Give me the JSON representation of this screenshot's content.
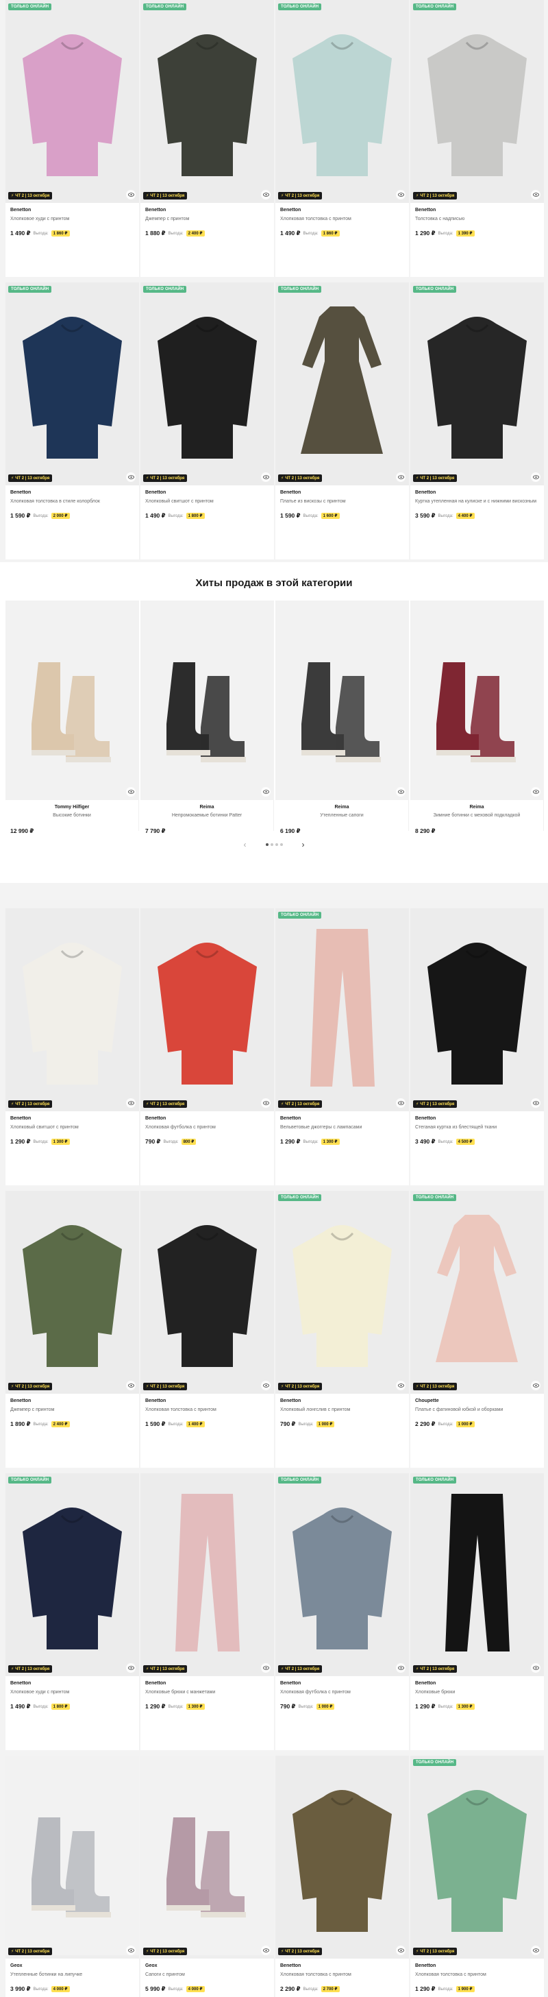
{
  "ui": {
    "badge": "Только онлайн",
    "delivery": "ЧТ 2 | 13 октября",
    "save_label": "Выгода:",
    "hits_title": "Хиты продаж в этой категории",
    "prev_arrow": "‹",
    "next_arrow": "›"
  },
  "colors": {
    "accent_green": "#56b887",
    "highlight_yellow": "#ffe052",
    "text": "#1a1a1a",
    "muted": "#666666"
  },
  "grid_top": [
    {
      "brand": "Benetton",
      "name": "Хлопковое худи с принтом",
      "price": "1 490 ₽",
      "save": "1 860 ₽",
      "badge": true,
      "color": "#d9a0c8"
    },
    {
      "brand": "Benetton",
      "name": "Джемпер с принтом",
      "price": "1 880 ₽",
      "save": "2 400 ₽",
      "badge": true,
      "color": "#3d4038"
    },
    {
      "brand": "Benetton",
      "name": "Хлопковая толстовка с принтом",
      "price": "1 490 ₽",
      "save": "1 860 ₽",
      "badge": true,
      "color": "#bcd6d3"
    },
    {
      "brand": "Benetton",
      "name": "Толстовка с надписью",
      "price": "1 290 ₽",
      "save": "1 390 ₽",
      "badge": true,
      "color": "#c9c9c7"
    },
    {
      "brand": "Benetton",
      "name": "Хлопковая толстовка в стиле колорблок",
      "price": "1 590 ₽",
      "save": "2 000 ₽",
      "badge": true,
      "color": "#1e3557"
    },
    {
      "brand": "Benetton",
      "name": "Хлопковый свитшот с принтом",
      "price": "1 490 ₽",
      "save": "1 800 ₽",
      "badge": true,
      "color": "#1f1f1f"
    },
    {
      "brand": "Benetton",
      "name": "Платье из вискозы с принтом",
      "price": "1 590 ₽",
      "save": "1 600 ₽",
      "badge": true,
      "color": "#56503f"
    },
    {
      "brand": "Benetton",
      "name": "Куртка утепленная на кулиске и с нижними вискозным",
      "price": "3 590 ₽",
      "save": "4 400 ₽",
      "badge": true,
      "color": "#262626"
    }
  ],
  "hits": [
    {
      "brand": "Tommy Hilfiger",
      "name": "Высокие ботинки",
      "price": "12 990 ₽",
      "color": "#dcc7ac"
    },
    {
      "brand": "Reima",
      "name": "Непромокаемые ботинки Patter",
      "price": "7 790 ₽",
      "color": "#2c2c2c"
    },
    {
      "brand": "Reima",
      "name": "Утепленные сапоги",
      "price": "6 190 ₽",
      "color": "#3b3b3b"
    },
    {
      "brand": "Reima",
      "name": "Зимние ботинки с меховой подкладкой",
      "price": "8 290 ₽",
      "color": "#7f2632"
    }
  ],
  "grid_bottom": [
    {
      "brand": "Benetton",
      "name": "Хлопковый свитшот с принтом",
      "price": "1 290 ₽",
      "save": "1 300 ₽",
      "badge": false,
      "color": "#f1efe9"
    },
    {
      "brand": "Benetton",
      "name": "Хлопковая футболка с принтом",
      "price": "790 ₽",
      "save": "800 ₽",
      "badge": false,
      "color": "#d9463a"
    },
    {
      "brand": "Benetton",
      "name": "Вельветовые джоггеры с лампасами",
      "price": "1 290 ₽",
      "save": "1 300 ₽",
      "badge": true,
      "color": "#e7bdb4"
    },
    {
      "brand": "Benetton",
      "name": "Стеганая куртка из блестящей ткани",
      "price": "3 490 ₽",
      "save": "4 500 ₽",
      "badge": false,
      "color": "#161616"
    },
    {
      "brand": "Benetton",
      "name": "Джемпер с принтом",
      "price": "1 890 ₽",
      "save": "2 400 ₽",
      "badge": false,
      "color": "#5b6b48"
    },
    {
      "brand": "Benetton",
      "name": "Хлопковая толстовка с принтом",
      "price": "1 590 ₽",
      "save": "1 400 ₽",
      "badge": false,
      "color": "#222222"
    },
    {
      "brand": "Benetton",
      "name": "Хлопковый лонгслив с принтом",
      "price": "790 ₽",
      "save": "1 000 ₽",
      "badge": true,
      "color": "#f3efd6"
    },
    {
      "brand": "Choupette",
      "name": "Платье с фатиновой юбкой и оборками",
      "price": "2 290 ₽",
      "save": "1 000 ₽",
      "badge": true,
      "color": "#ecc7bd"
    },
    {
      "brand": "Benetton",
      "name": "Хлопковое худи с принтом",
      "price": "1 490 ₽",
      "save": "1 800 ₽",
      "badge": true,
      "color": "#1e2640"
    },
    {
      "brand": "Benetton",
      "name": "Хлопковые брюки с манжетами",
      "price": "1 290 ₽",
      "save": "1 300 ₽",
      "badge": false,
      "color": "#e3bcbd"
    },
    {
      "brand": "Benetton",
      "name": "Хлопковая футболка с принтом",
      "price": "790 ₽",
      "save": "1 000 ₽",
      "badge": true,
      "color": "#7b8a99"
    },
    {
      "brand": "Benetton",
      "name": "Хлопковые брюки",
      "price": "1 290 ₽",
      "save": "1 300 ₽",
      "badge": true,
      "color": "#141414"
    },
    {
      "brand": "Geox",
      "name": "Утепленные ботинки на липучке",
      "price": "3 990 ₽",
      "save": "4 000 ₽",
      "badge": false,
      "color": "#b9bbc0"
    },
    {
      "brand": "Geox",
      "name": "Сапоги с принтом",
      "price": "5 990 ₽",
      "save": "4 000 ₽",
      "badge": false,
      "color": "#b59aa6"
    },
    {
      "brand": "Benetton",
      "name": "Хлопковая толстовка с принтом",
      "price": "2 290 ₽",
      "save": "2 700 ₽",
      "badge": false,
      "color": "#6a5d3f"
    },
    {
      "brand": "Benetton",
      "name": "Хлопковая толстовка с принтом",
      "price": "1 290 ₽",
      "save": "1 900 ₽",
      "badge": true,
      "color": "#7bb190"
    }
  ]
}
